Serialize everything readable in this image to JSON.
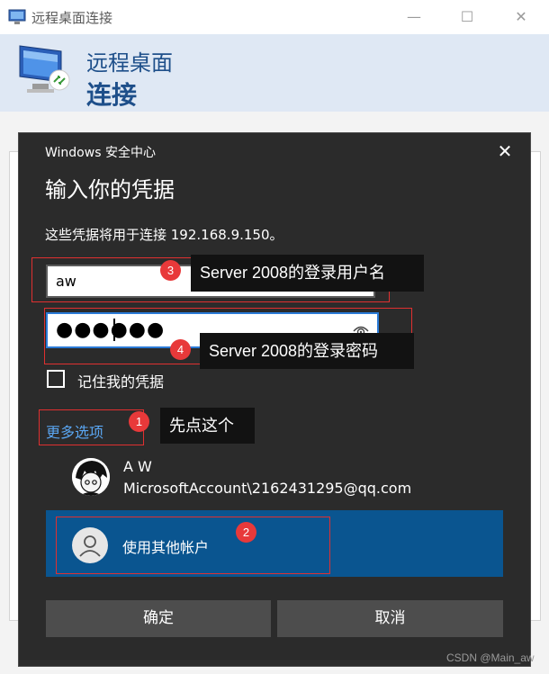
{
  "window": {
    "title": "远程桌面连接",
    "header_line1": "远程桌面",
    "header_line2": "连接",
    "minimize": "—",
    "maximize": "☐",
    "close": "✕"
  },
  "dialog": {
    "caption": "Windows 安全中心",
    "close": "✕",
    "heading": "输入你的凭据",
    "description": "这些凭据将用于连接 192.168.9.150。",
    "username_value": "aw",
    "password_value": "●●●●●●",
    "remember_label": "记住我的凭据",
    "remember_checked": false,
    "more_options": "更多选项",
    "account": {
      "name": "A W",
      "email": "MicrosoftAccount\\2162431295@qq.com"
    },
    "other_account_label": "使用其他帐户",
    "ok_button": "确定",
    "cancel_button": "取消"
  },
  "annotations": [
    {
      "number": "1",
      "text": "先点这个"
    },
    {
      "number": "2",
      "text": ""
    },
    {
      "number": "3",
      "text": "Server 2008的登录用户名"
    },
    {
      "number": "4",
      "text": "Server 2008的登录密码"
    }
  ],
  "watermark": "CSDN @Main_aw",
  "colors": {
    "dialog_bg": "#2b2b2b",
    "accent_blue": "#0a5590",
    "link_blue": "#5aa6f2",
    "badge_red": "#e8393a",
    "header_blue": "#1e4f8a"
  }
}
